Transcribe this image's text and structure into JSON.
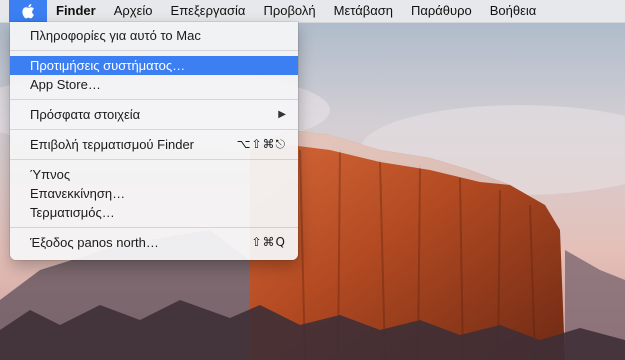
{
  "menubar": {
    "apple_icon": "apple-logo-icon",
    "menus": [
      {
        "label": "Finder",
        "bold": true
      },
      {
        "label": "Αρχείο"
      },
      {
        "label": "Επεξεργασία"
      },
      {
        "label": "Προβολή"
      },
      {
        "label": "Μετάβαση"
      },
      {
        "label": "Παράθυρο"
      },
      {
        "label": "Βοήθεια"
      }
    ]
  },
  "apple_menu": {
    "items": [
      {
        "label": "Πληροφορίες για αυτό το Mac"
      },
      {
        "label": "Προτιμήσεις συστήματος…",
        "highlighted": true
      },
      {
        "label": "App Store…"
      },
      {
        "label": "Πρόσφατα στοιχεία",
        "submenu": "▶"
      },
      {
        "label": "Επιβολή τερματισμού Finder",
        "shortcut": "⌥⇧⌘⎋"
      },
      {
        "label": "Ύπνος"
      },
      {
        "label": "Επανεκκίνηση…"
      },
      {
        "label": "Τερματισμός…"
      },
      {
        "label": "Έξοδος panos north…",
        "shortcut": "⇧⌘Q"
      }
    ]
  },
  "colors": {
    "highlight": "#3b7ff3",
    "menubar_bg": "#ececee",
    "dropdown_bg": "#f4f4f6"
  }
}
